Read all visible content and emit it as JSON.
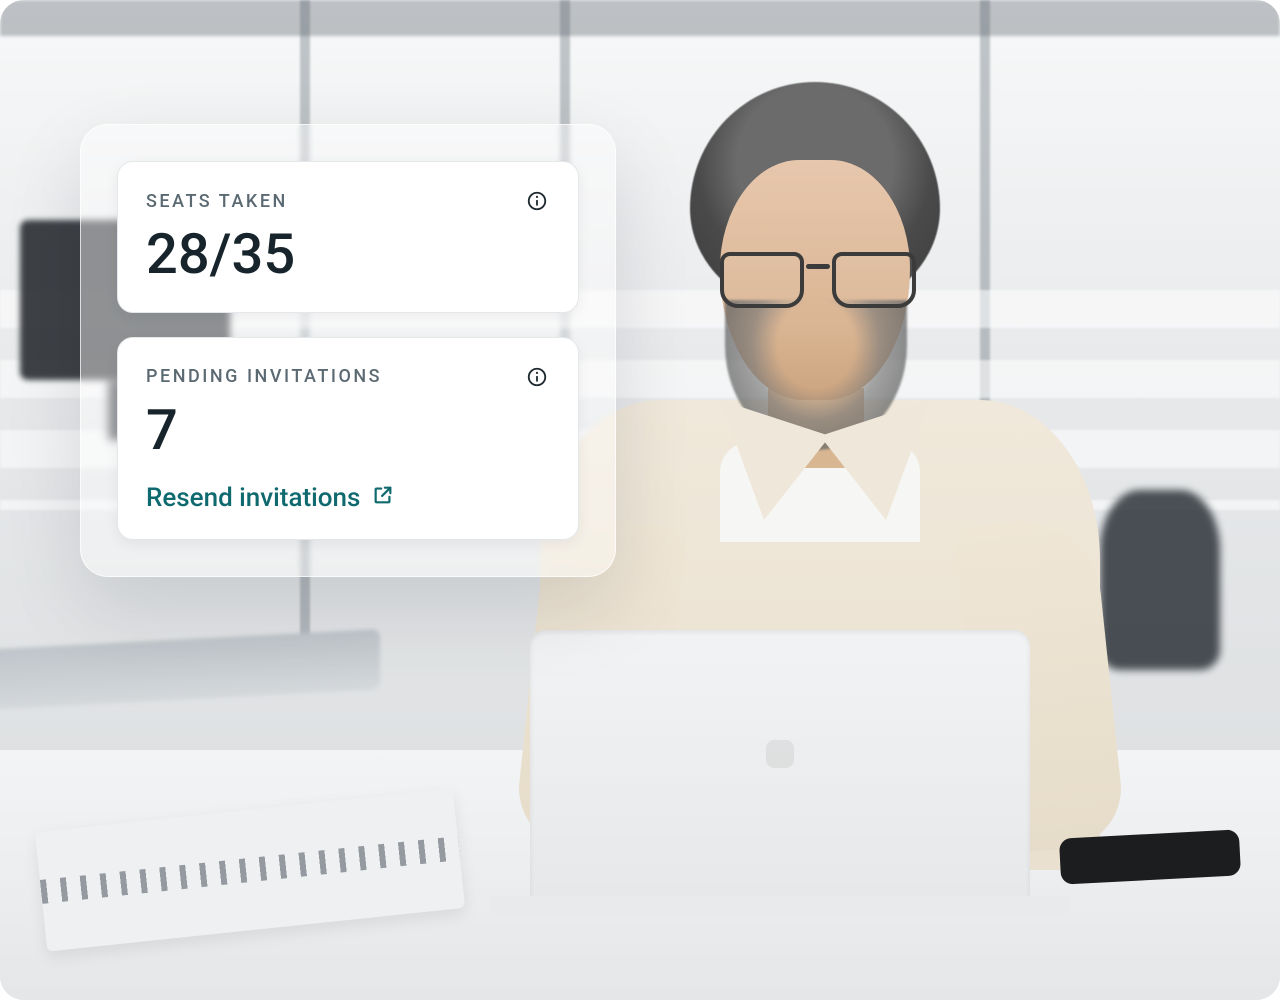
{
  "colors": {
    "accent": "#0f6a70",
    "text": "#17242b",
    "muted": "#5b6a72"
  },
  "cards": {
    "seats": {
      "label": "SEATS TAKEN",
      "value": "28/35"
    },
    "pending": {
      "label": "PENDING INVITATIONS",
      "value": "7",
      "action_label": "Resend invitations"
    }
  }
}
